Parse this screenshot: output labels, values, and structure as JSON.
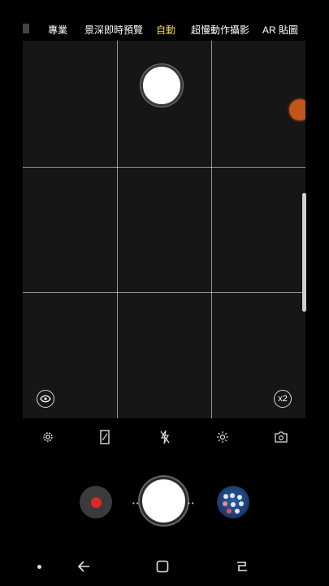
{
  "camera_modes": {
    "items": [
      {
        "label": "專業",
        "active": false
      },
      {
        "label": "景深即時預覽",
        "active": false
      },
      {
        "label": "自動",
        "active": true
      },
      {
        "label": "超慢動作攝影",
        "active": false
      },
      {
        "label": "AR 貼圖",
        "active": false
      }
    ],
    "active_color": "#e8d84a"
  },
  "viewfinder": {
    "zoom_label": "x2",
    "background": "#161616",
    "grid_lines": true
  },
  "settings_row": {
    "icons": [
      "gear-icon",
      "aspect-ratio-icon",
      "flash-off-icon",
      "effects-icon",
      "switch-camera-icon"
    ]
  },
  "controls": {
    "record_color": "#e32525",
    "shutter_color": "#ffffff"
  },
  "nav_bar": {
    "icons": [
      "indicator-dot-icon",
      "back-icon",
      "home-icon",
      "recents-icon"
    ]
  }
}
